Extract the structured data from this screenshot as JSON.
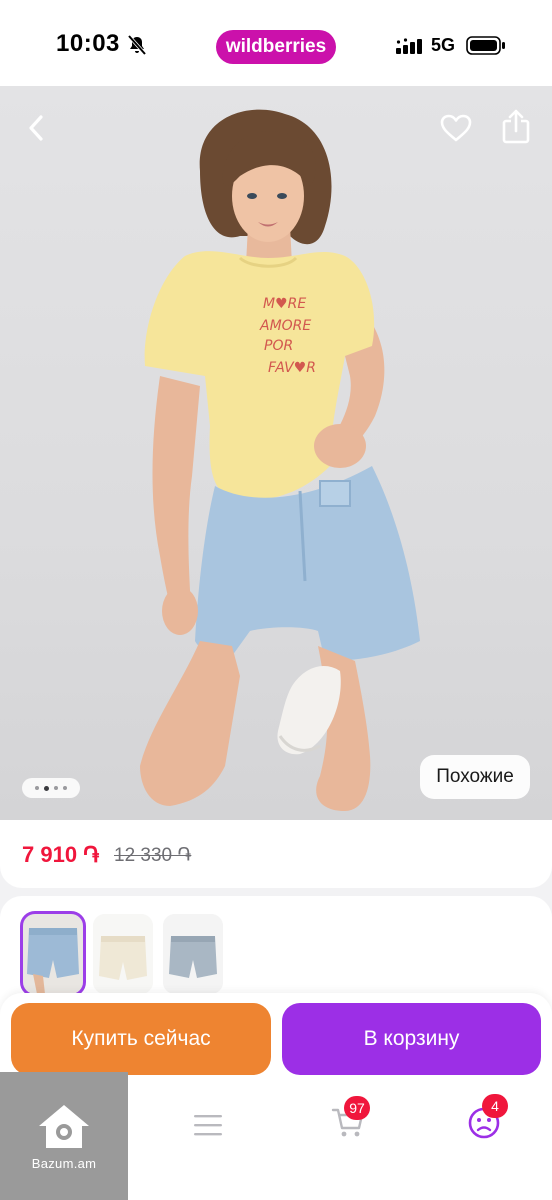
{
  "status_bar": {
    "time": "10:03",
    "brand": "wildberries",
    "network": "5G",
    "brand_color": "#cb11ab"
  },
  "gallery": {
    "current_image_index": 1,
    "total_images": 4,
    "shirt_print_lines": [
      "M♥RE",
      "AMORE",
      "POR",
      "FAV♥R"
    ],
    "similar_label": "Похожие"
  },
  "price": {
    "current": "7 910 ֏",
    "old": "12 330 ֏",
    "current_color": "#f0163c"
  },
  "variants": [
    {
      "name": "light-blue-shorts",
      "selected": true
    },
    {
      "name": "cream-shorts",
      "selected": false
    },
    {
      "name": "grey-shorts",
      "selected": false
    }
  ],
  "actions": {
    "buy_now_label": "Купить сейчас",
    "add_to_cart_label": "В корзину",
    "buy_now_color": "#ee8431",
    "add_to_cart_color": "#9c2fe6"
  },
  "bottom_nav": {
    "home_label": "Bazum.am",
    "cart_count": "97",
    "profile_count": "4",
    "icons": [
      "house-icon",
      "menu-icon",
      "cart-icon",
      "profile-icon"
    ]
  }
}
